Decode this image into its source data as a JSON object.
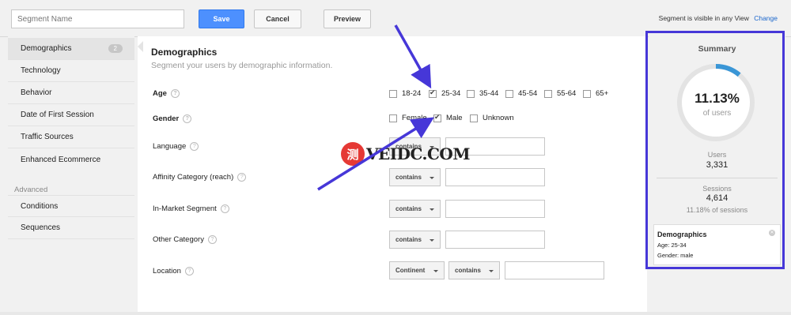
{
  "topbar": {
    "segment_placeholder": "Segment Name",
    "save": "Save",
    "cancel": "Cancel",
    "preview": "Preview",
    "visible_text": "Segment is visible in any View",
    "change": "Change"
  },
  "sidebar": {
    "items": [
      {
        "label": "Demographics",
        "badge": "2"
      },
      {
        "label": "Technology"
      },
      {
        "label": "Behavior"
      },
      {
        "label": "Date of First Session"
      },
      {
        "label": "Traffic Sources"
      },
      {
        "label": "Enhanced Ecommerce"
      }
    ],
    "advanced_heading": "Advanced",
    "advanced_items": [
      {
        "label": "Conditions"
      },
      {
        "label": "Sequences"
      }
    ]
  },
  "main": {
    "title": "Demographics",
    "subtitle": "Segment your users by demographic information.",
    "age_label": "Age",
    "age_options": [
      "18-24",
      "25-34",
      "35-44",
      "45-54",
      "55-64",
      "65+"
    ],
    "gender_label": "Gender",
    "gender_options": [
      "Female",
      "Male",
      "Unknown"
    ],
    "rows": [
      {
        "label": "Language",
        "op": "contains"
      },
      {
        "label": "Affinity Category (reach)",
        "op": "contains"
      },
      {
        "label": "In-Market Segment",
        "op": "contains"
      },
      {
        "label": "Other Category",
        "op": "contains"
      }
    ],
    "location": {
      "label": "Location",
      "scope": "Continent",
      "op": "contains"
    },
    "help_glyph": "?"
  },
  "summary": {
    "title": "Summary",
    "percent": "11.13%",
    "percent_sub": "of users",
    "percent_value": 11.13,
    "users_label": "Users",
    "users_value": "3,331",
    "sessions_label": "Sessions",
    "sessions_value": "4,614",
    "sessions_pct": "11.18% of sessions",
    "chip_title": "Demographics",
    "chip_age": "Age: 25-34",
    "chip_gender": "Gender: male"
  },
  "watermark": {
    "badge": "测",
    "text": "VEIDC.COM"
  },
  "colors": {
    "accent_blue": "#4d90fe",
    "annotation_purple": "#4637d8",
    "ring_blue": "#3a96d6",
    "watermark_red": "#e53935"
  }
}
